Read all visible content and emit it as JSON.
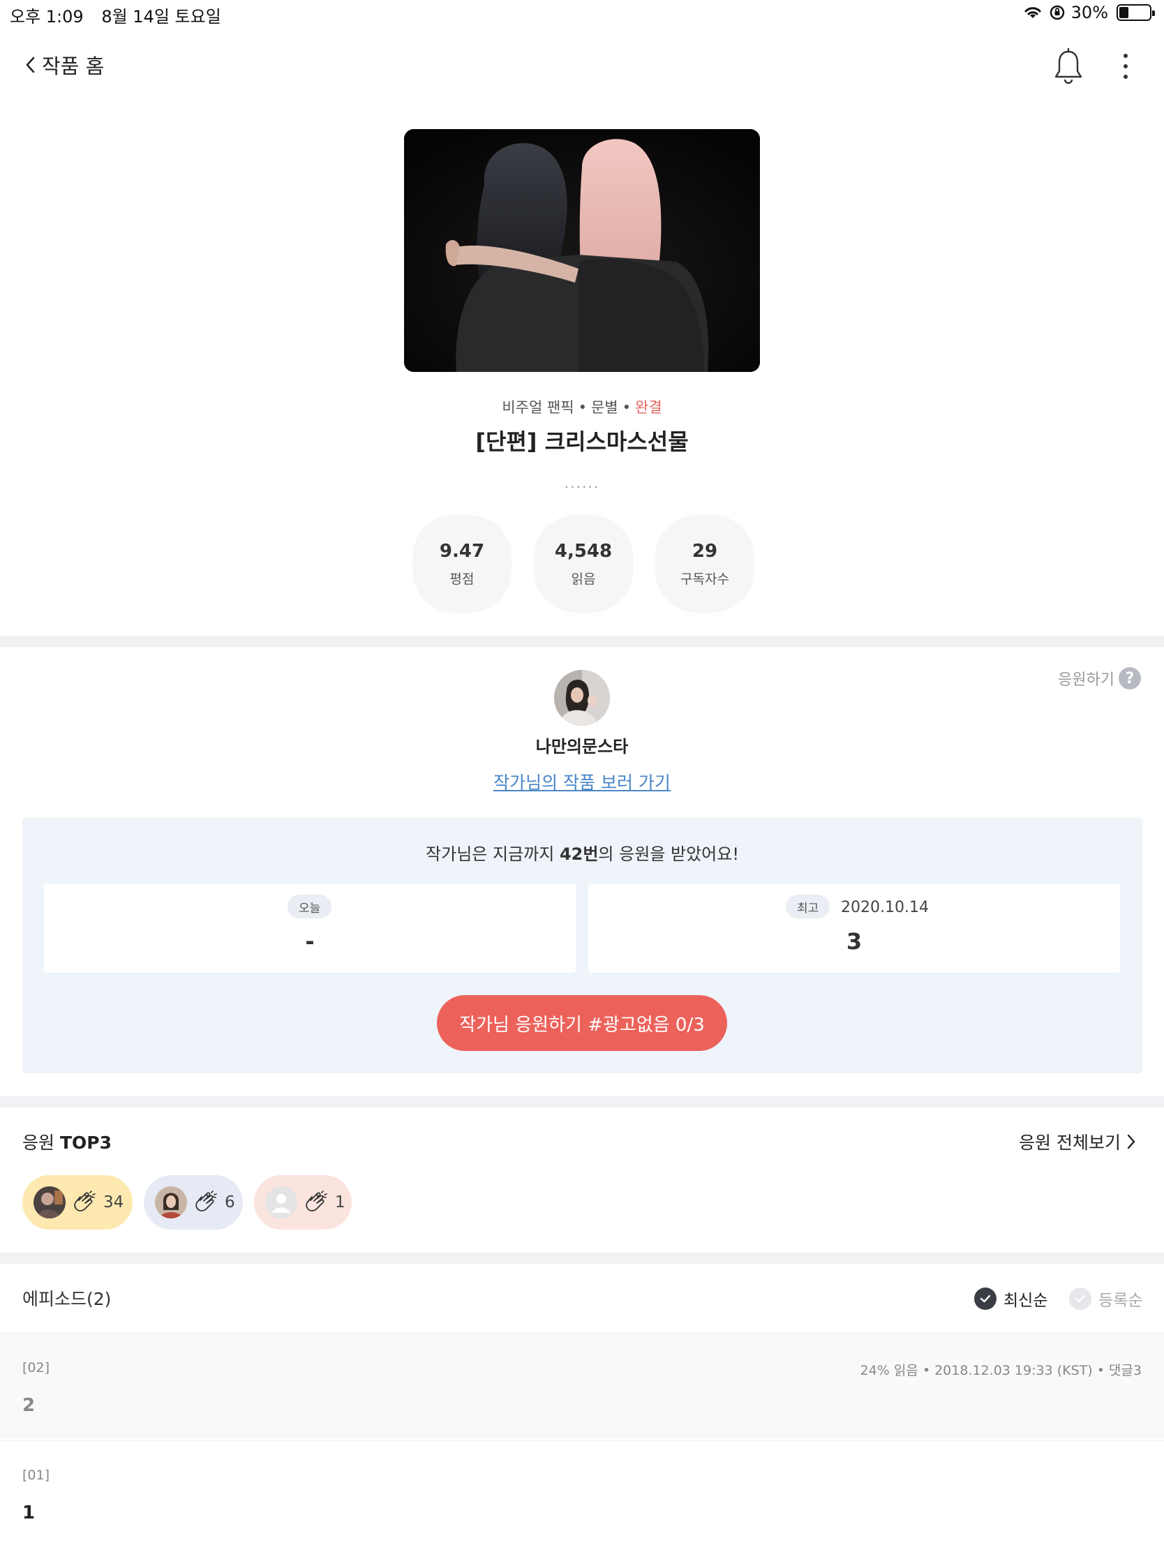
{
  "status_bar": {
    "time": "오후 1:09",
    "date": "8월 14일 토요일",
    "battery_text": "30%",
    "battery_level": 0.3
  },
  "nav": {
    "back_label": "작품 홈",
    "icons": [
      "chevron-left-icon",
      "bell-icon",
      "more-vertical-icon"
    ]
  },
  "work": {
    "category": "비주얼 팬픽",
    "type": "문별",
    "status": "완결",
    "title": "[단편] 크리스마스선물",
    "description": "......",
    "stats": [
      {
        "value": "9.47",
        "label": "평점"
      },
      {
        "value": "4,548",
        "label": "읽음"
      },
      {
        "value": "29",
        "label": "구독자수"
      }
    ]
  },
  "author": {
    "name": "나만의문스타",
    "link_label": "작가님의 작품 보러 가기",
    "support_help_label": "응원하기",
    "help_icon_text": "?"
  },
  "support": {
    "summary_pre": "작가님은 지금까지 ",
    "summary_count": "42번",
    "summary_post": "의 응원을 받았어요!",
    "today_label": "오늘",
    "today_value": "-",
    "best_label": "최고",
    "best_date": "2020.10.14",
    "best_value": "3",
    "button_label": "작가님 응원하기 #광고없음 0/3",
    "accent_color": "#ec625b"
  },
  "top3": {
    "title_pre": "응원 ",
    "title_bold": "TOP3",
    "view_all_label": "응원 전체보기",
    "fans": [
      {
        "count": "34",
        "color": "#fde9b0"
      },
      {
        "count": "6",
        "color": "#e6eaf4"
      },
      {
        "count": "1",
        "color": "#fbe3de"
      }
    ]
  },
  "episodes": {
    "header": "에피소드(2)",
    "sort_latest": "최신순",
    "sort_register": "등록순",
    "items": [
      {
        "num": "[02]",
        "meta": "24% 읽음 • 2018.12.03 19:33 (KST) • 댓글3",
        "title": "2"
      },
      {
        "num": "[01]",
        "meta": "",
        "title": "1"
      }
    ]
  }
}
